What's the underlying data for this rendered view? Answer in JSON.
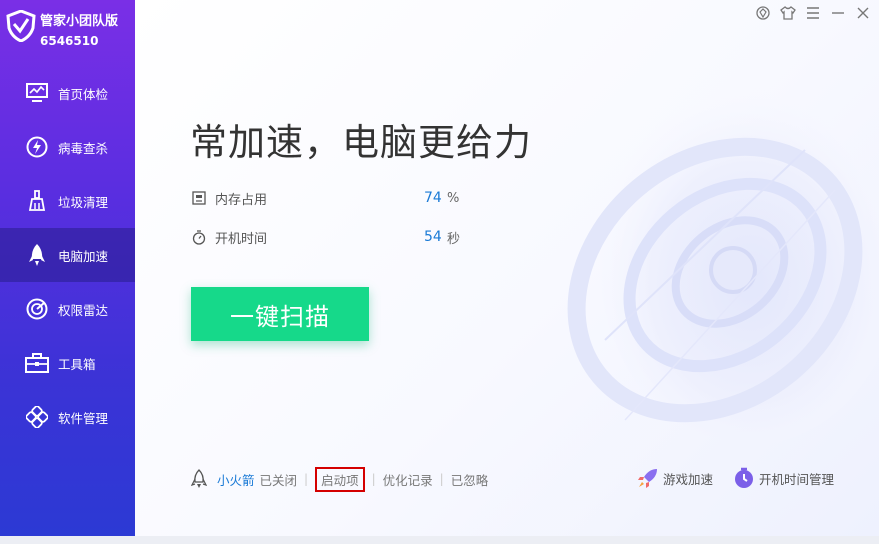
{
  "brand": {
    "name": "管家小团队版",
    "id": "6546510"
  },
  "nav": [
    {
      "key": "home",
      "label": "首页体检",
      "icon": "monitor-icon"
    },
    {
      "key": "virus",
      "label": "病毒查杀",
      "icon": "lightning-shield-icon"
    },
    {
      "key": "clean",
      "label": "垃圾清理",
      "icon": "broom-icon"
    },
    {
      "key": "speed",
      "label": "电脑加速",
      "icon": "rocket-icon",
      "active": true
    },
    {
      "key": "radar",
      "label": "权限雷达",
      "icon": "radar-icon"
    },
    {
      "key": "toolbox",
      "label": "工具箱",
      "icon": "toolbox-icon"
    },
    {
      "key": "software",
      "label": "软件管理",
      "icon": "apps-icon"
    }
  ],
  "window_controls": [
    "skin-diamond-icon",
    "tshirt-icon",
    "menu-icon",
    "minimize-icon",
    "close-icon"
  ],
  "main": {
    "headline": "常加速，电脑更给力",
    "memory": {
      "label": "内存占用",
      "value": "74",
      "unit": "%"
    },
    "uptime": {
      "label": "开机时间",
      "value": "54",
      "unit": "秒"
    },
    "scan_button": "一键扫描"
  },
  "footer": {
    "rocket_label": "小火箭",
    "rocket_status": "已关闭",
    "startup_items": "启动项",
    "optimize_history": "优化记录",
    "ignored": "已忽略",
    "game_boost": "游戏加速",
    "boot_time_manager": "开机时间管理"
  },
  "colors": {
    "sidebar_top": "#7a2fe6",
    "sidebar_bottom": "#2b3ad4",
    "accent_green": "#16d98a",
    "value_blue": "#1a7ad6",
    "highlight_red": "#d40000"
  }
}
